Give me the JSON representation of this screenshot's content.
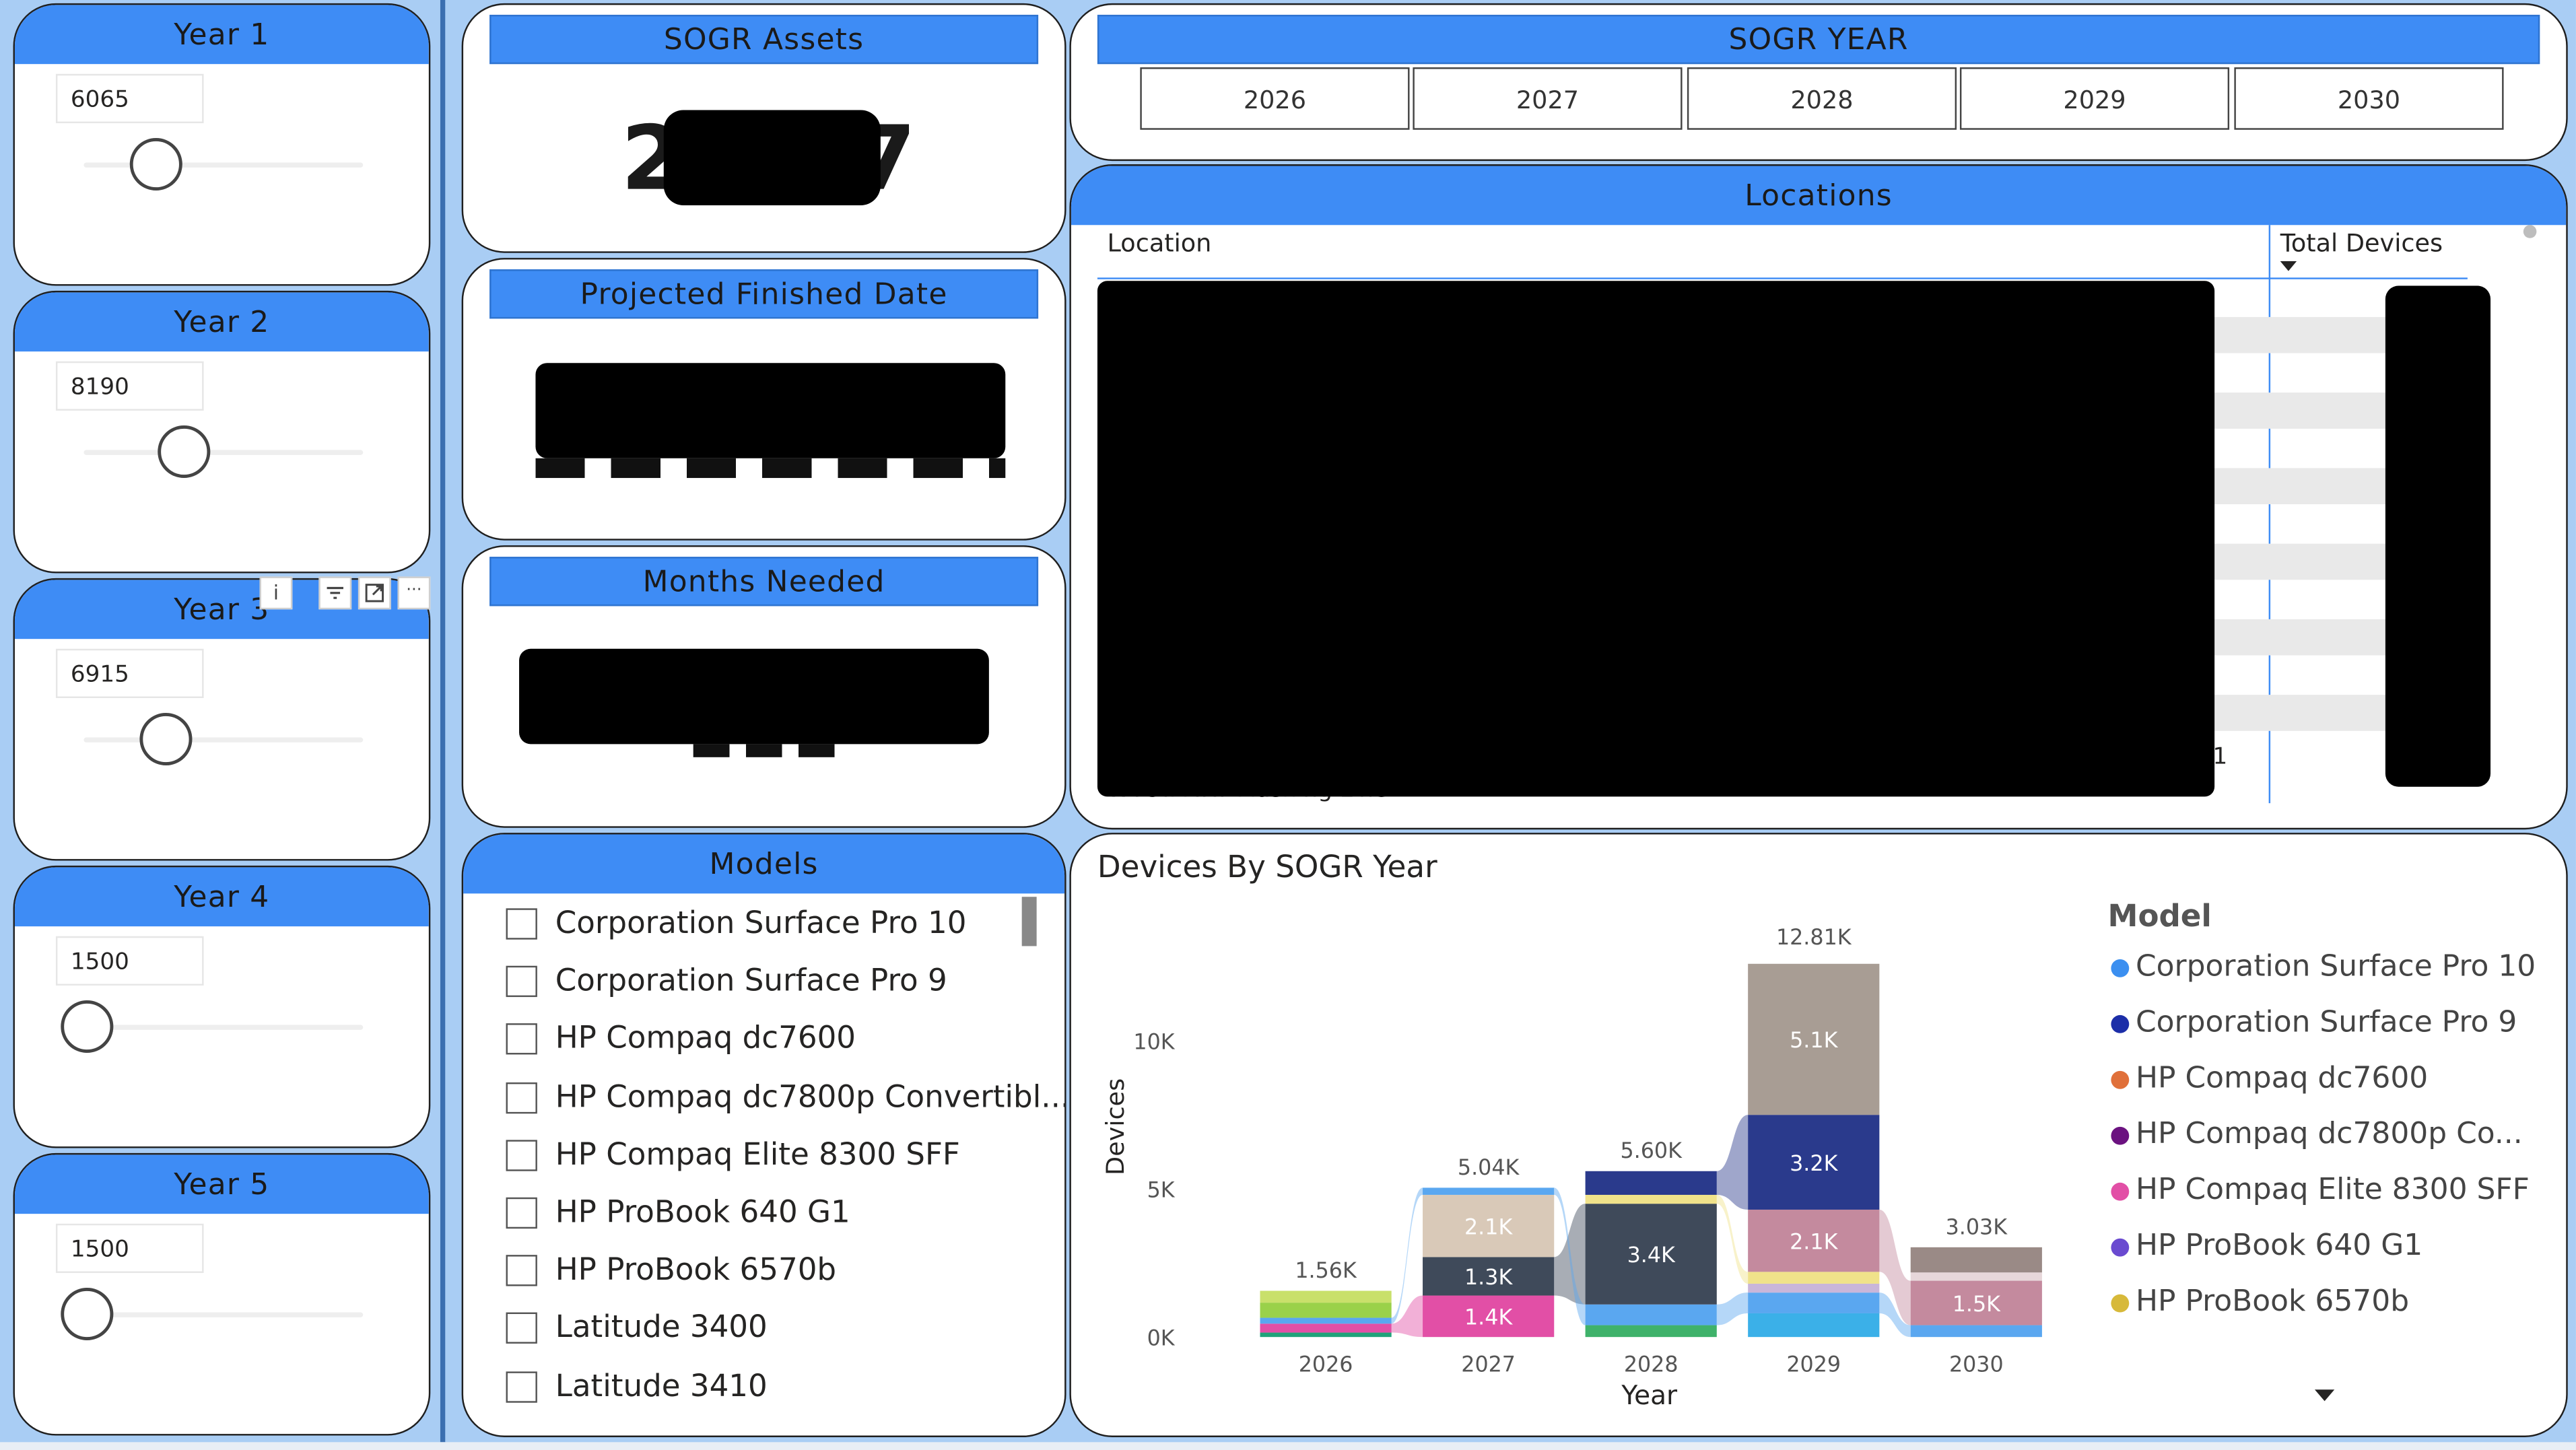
{
  "year_sliders": [
    {
      "title": "Year 1",
      "value": "6065",
      "level": 0.26
    },
    {
      "title": "Year 2",
      "value": "8190",
      "level": 0.37
    },
    {
      "title": "Year 3",
      "value": "6915",
      "level": 0.3
    },
    {
      "title": "Year 4",
      "value": "1500",
      "level": 0.0
    },
    {
      "title": "Year 5",
      "value": "1500",
      "level": 0.0
    }
  ],
  "kpis": {
    "assets_title": "SOGR Assets",
    "assets_value_visible_start": "2",
    "assets_value_visible_end": "7",
    "finished_title": "Projected Finished Date",
    "months_title": "Months Needed"
  },
  "sogr_year": {
    "title": "SOGR YEAR",
    "options": [
      "2026",
      "2027",
      "2028",
      "2029",
      "2030"
    ]
  },
  "locations": {
    "title": "Locations",
    "col_location": "Location",
    "col_total": "Total Devices",
    "partial_row_text": "WTCTA IRT Flashing Line",
    "partial_number": "01"
  },
  "models_slicer": {
    "title": "Models",
    "items": [
      "Corporation Surface Pro 10",
      "Corporation Surface Pro 9",
      "HP Compaq dc7600",
      "HP Compaq dc7800p Convertibl...",
      "HP Compaq Elite 8300 SFF",
      "HP ProBook 640 G1",
      "HP ProBook 6570b",
      "Latitude 3400",
      "Latitude 3410"
    ]
  },
  "visual_header_icons": [
    "info-icon",
    "filter-icon",
    "focus-mode-icon",
    "more-options-icon"
  ],
  "visual_header_text": {
    "info": "i",
    "more": "···"
  },
  "chart_title": "Devices By SOGR Year",
  "chart_data": {
    "type": "area",
    "subtype": "ribbon-stacked",
    "title": "Devices By SOGR Year",
    "xlabel": "Year",
    "ylabel": "Devices",
    "categories": [
      "2026",
      "2027",
      "2028",
      "2029",
      "2030"
    ],
    "totals": [
      1560,
      5040,
      5600,
      12810,
      3030
    ],
    "total_labels": [
      "1.56K",
      "5.04K",
      "5.60K",
      "12.81K",
      "3.03K"
    ],
    "ylim": [
      0,
      13000
    ],
    "yticks": [
      {
        "v": 0,
        "label": "0K"
      },
      {
        "v": 5000,
        "label": "5K"
      },
      {
        "v": 10000,
        "label": "10K"
      }
    ],
    "legend_title": "Model",
    "legend_position": "right",
    "legend": [
      {
        "name": "Corporation Surface Pro 10",
        "color": "#3b8ff0"
      },
      {
        "name": "Corporation Surface Pro 9",
        "color": "#1c2ea8"
      },
      {
        "name": "HP Compaq dc7600",
        "color": "#e0703a"
      },
      {
        "name": "HP Compaq dc7800p Co...",
        "color": "#6b1280"
      },
      {
        "name": "HP Compaq Elite 8300 SFF",
        "color": "#e24fa6"
      },
      {
        "name": "HP ProBook 640 G1",
        "color": "#6a4ad0"
      },
      {
        "name": "HP ProBook 6570b",
        "color": "#d7b93a"
      }
    ],
    "segment_labels": [
      {
        "category": "2027",
        "label": "1.4K",
        "value": 1400
      },
      {
        "category": "2027",
        "label": "1.3K",
        "value": 1300
      },
      {
        "category": "2027",
        "label": "2.1K",
        "value": 2100
      },
      {
        "category": "2028",
        "label": "3.4K",
        "value": 3400
      },
      {
        "category": "2029",
        "label": "2.1K",
        "value": 2100
      },
      {
        "category": "2029",
        "label": "3.2K",
        "value": 3200
      },
      {
        "category": "2029",
        "label": "5.1K",
        "value": 5100
      },
      {
        "category": "2030",
        "label": "1.5K",
        "value": 1500
      }
    ],
    "stacks": {
      "2026": [
        {
          "c": "#20a37a",
          "v": 150
        },
        {
          "c": "#e24fa6",
          "v": 300
        },
        {
          "c": "#5aa7f0",
          "v": 200
        },
        {
          "c": "#9ad14a",
          "v": 510
        },
        {
          "c": "#c9e06b",
          "v": 400
        }
      ],
      "2027": [
        {
          "c": "#e24fa6",
          "v": 1400
        },
        {
          "c": "#3f4a5a",
          "v": 1300
        },
        {
          "c": "#d9c9b8",
          "v": 2100
        },
        {
          "c": "#5aa7f0",
          "v": 240
        }
      ],
      "2028": [
        {
          "c": "#3fb26a",
          "v": 400
        },
        {
          "c": "#5aa7f0",
          "v": 700
        },
        {
          "c": "#3f4a5a",
          "v": 3400
        },
        {
          "c": "#f0e28a",
          "v": 300
        },
        {
          "c": "#2a3a8c",
          "v": 800
        }
      ],
      "2029": [
        {
          "c": "#3bb0e8",
          "v": 800
        },
        {
          "c": "#5aa7f0",
          "v": 700
        },
        {
          "c": "#c9b6d9",
          "v": 300
        },
        {
          "c": "#f0e28a",
          "v": 400
        },
        {
          "c": "#c48a9e",
          "v": 2100
        },
        {
          "c": "#2a3a8c",
          "v": 3200
        },
        {
          "c": "#a89d94",
          "v": 5100
        }
      ],
      "2030": [
        {
          "c": "#5aa7f0",
          "v": 400
        },
        {
          "c": "#c48a9e",
          "v": 1500
        },
        {
          "c": "#e7d7da",
          "v": 280
        },
        {
          "c": "#9a8a86",
          "v": 850
        }
      ]
    }
  }
}
